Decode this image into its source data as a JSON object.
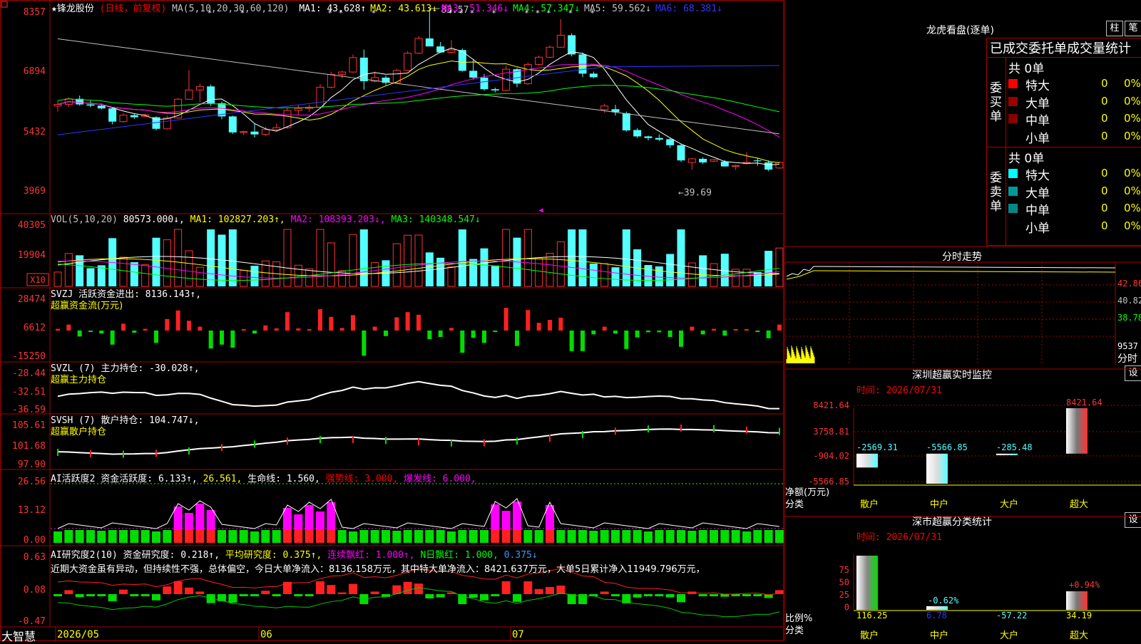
{
  "chart_header": {
    "title": "★锋龙股份",
    "mode": "(日线，前复权)",
    "ma_prefix": "MA(5,10,20,30,60,120)",
    "ma": [
      {
        "label": "MA1:",
        "value": "43.628↑",
        "color": "#ffffff"
      },
      {
        "label": "MA2:",
        "value": "43.613↓",
        "color": "#ffff00"
      },
      {
        "label": "MA3:",
        "value": "51.346↓",
        "color": "#ff00ff"
      },
      {
        "label": "MA4:",
        "value": "57.347↓",
        "color": "#00ff00"
      },
      {
        "label": "MA5:",
        "value": "59.562↓",
        "color": "#c0c0c0"
      },
      {
        "label": "MA6:",
        "value": "68.381↓",
        "color": "#3333ff"
      }
    ],
    "high_label": "83.57",
    "low_label": "←39.69"
  },
  "y_axes": {
    "price": [
      "8357",
      "6894",
      "5432",
      "3969"
    ],
    "vol": [
      "40305",
      "19904"
    ],
    "vol_unit": "X10",
    "svzj": [
      "28474",
      "6612",
      "-15250"
    ],
    "svzl": [
      "-28.44",
      "-32.51",
      "-36.59"
    ],
    "svsh": [
      "105.61",
      "101.68",
      "97.90"
    ],
    "ai1": [
      "26.56",
      "13.12",
      "0.00"
    ],
    "ai2": [
      "0.63",
      "0.08",
      "-0.47"
    ]
  },
  "panels": {
    "vol_header": "VOL(5,10,20)",
    "vol_value": "80573.000↓,",
    "vol_ma1": "MA1: 102827.203↑,",
    "vol_ma2": "MA2: 108393.203↓,",
    "vol_ma3": "MA3: 140348.547↓",
    "svzj_header": "SVZJ  活跃资金进出: 8136.143↑,",
    "svzj_sub": "超赢资金流(万元)",
    "svzl_header": "SVZL (7) 主力持仓: -30.028↑,",
    "svzl_sub": "超赢主力持仓",
    "svsh_header": "SVSH (7) 散户持仓: 104.747↓,",
    "svsh_sub": "超赢散户持仓",
    "ai1_header": "AI活跃度2 资金活跃度: 6.133↑,",
    "ai1_val2": "26.561,",
    "ai1_life": "生命线: 1.560,",
    "ai1_strong": "强势线: 3.000,",
    "ai1_burst": "爆发线: 6.000,",
    "ai2_header": "AI研究度2(10) 资金研究度: 0.218↑,",
    "ai2_avg": "平均研究度: 0.375↑,",
    "ai2_cont": "连续飘红: 1.000↑,",
    "ai2_n": "N日飘红: 1.000,",
    "ai2_last": "0.375↓",
    "ai2_comment": "近期大资金虽有异动，但持续性不强，总体偏空，今日大单净流入：8136.158万元，其中特大单净流入：8421.637万元，大单5日累计净入11949.796万元，"
  },
  "x_axis": {
    "labels": [
      "2026/05",
      "06",
      "07"
    ]
  },
  "brand": "大智慧",
  "right": {
    "lhb_title": "龙虎看盘(逐单)",
    "btn_bar": "柱",
    "btn_pen": "笔",
    "tabs": "已成交委托单成交量统计",
    "buy_side": "委买单",
    "sell_side": "委卖单",
    "buy_total": "共 0单",
    "sell_total": "共 0单",
    "buy_rows": [
      {
        "name": "特大",
        "count": "0",
        "pct": "0%",
        "color": "#ff0000"
      },
      {
        "name": "大单",
        "count": "0",
        "pct": "0%",
        "color": "#990000"
      },
      {
        "name": "中单",
        "count": "0",
        "pct": "0%",
        "color": "#880000"
      },
      {
        "name": "小单",
        "count": "0",
        "pct": "0%",
        "color": "#000000"
      }
    ],
    "sell_rows": [
      {
        "name": "特大",
        "count": "0",
        "pct": "0%",
        "color": "#00ffff"
      },
      {
        "name": "大单",
        "count": "0",
        "pct": "0%",
        "color": "#009999"
      },
      {
        "name": "中单",
        "count": "0",
        "pct": "0%",
        "color": "#008888"
      },
      {
        "name": "小单",
        "count": "0",
        "pct": "0%",
        "color": "#000000"
      }
    ],
    "fenshi_title": "分时走势",
    "fenshi_axis": [
      "42.86",
      "40.82",
      "38.78"
    ],
    "fenshi_vol": "9537",
    "fenshi_label": "分时",
    "sz_monitor_title": "深圳超赢实时监控",
    "sz_btn": "设",
    "sz_time": "时间: 2026/07/31",
    "sz_axis": [
      "8421.64",
      "3758.81",
      "-904.02",
      "-5566.85"
    ],
    "sz_unit": "净额(万元)",
    "sz_cat_label": "分类",
    "sz_categories": [
      "散户",
      "中户",
      "大户",
      "超大"
    ],
    "sz_values": [
      -2569.31,
      -5566.85,
      -285.48,
      8421.64
    ],
    "sz_value_labels": [
      "-2569.31",
      "-5566.85",
      "-285.48",
      "8421.64"
    ],
    "sc_title": "深市超赢分类统计",
    "sc_btn": "设",
    "sc_time": "时间: 2026/07/31",
    "sc_axis": [
      "75",
      "50",
      "25",
      "0"
    ],
    "sc_unit": "比例%",
    "sc_cat_label": "分类",
    "sc_categories": [
      "散户",
      "中户",
      "大户",
      "超大"
    ],
    "sc_values": [
      "116.25",
      "6.78",
      "-57.22",
      "34.19"
    ],
    "sc_bar_labels": [
      "-0.62%",
      "+0.94%"
    ]
  },
  "chart_data": [
    {
      "type": "candlestick",
      "title": "锋龙股份 (日线，前复权)",
      "ylim": [
        36.9,
        83.57
      ],
      "x": [
        "2026/05",
        "06",
        "07"
      ],
      "ohlc": [
        [
          59.2,
          60.5,
          57.8,
          59.6
        ],
        [
          59.6,
          61.4,
          59.0,
          61.0
        ],
        [
          61.0,
          61.8,
          59.3,
          59.6
        ],
        [
          59.6,
          60.5,
          58.9,
          59.3
        ],
        [
          59.3,
          59.8,
          58.4,
          58.6
        ],
        [
          58.6,
          58.9,
          54.6,
          55.3
        ],
        [
          55.3,
          57.4,
          55.0,
          56.9
        ],
        [
          56.9,
          57.3,
          56.0,
          56.4
        ],
        [
          56.6,
          57.3,
          56.5,
          57.0
        ],
        [
          56.4,
          56.6,
          53.1,
          53.5
        ],
        [
          53.5,
          56.8,
          53.3,
          56.2
        ],
        [
          56.2,
          61.2,
          56.0,
          60.9
        ],
        [
          60.9,
          68.2,
          60.8,
          63.2
        ],
        [
          63.2,
          64.8,
          60.1,
          64.1
        ],
        [
          64.1,
          64.6,
          59.2,
          59.9
        ],
        [
          59.9,
          60.3,
          55.9,
          56.6
        ],
        [
          56.6,
          56.8,
          52.2,
          52.6
        ],
        [
          52.6,
          53.0,
          51.9,
          52.8
        ],
        [
          52.8,
          54.7,
          51.3,
          52.1
        ],
        [
          52.1,
          54.0,
          51.7,
          53.3
        ],
        [
          53.3,
          54.8,
          52.9,
          53.8
        ],
        [
          53.8,
          58.8,
          53.5,
          58.1
        ],
        [
          58.1,
          59.4,
          57.0,
          58.6
        ],
        [
          58.6,
          59.5,
          57.7,
          58.9
        ],
        [
          58.9,
          64.7,
          58.5,
          63.9
        ],
        [
          63.9,
          67.8,
          63.6,
          67.1
        ],
        [
          67.1,
          68.0,
          66.1,
          67.7
        ],
        [
          67.7,
          72.1,
          67.5,
          71.3
        ],
        [
          71.3,
          73.3,
          63.3,
          65.4
        ],
        [
          65.4,
          67.8,
          65.1,
          66.3
        ],
        [
          66.3,
          66.8,
          64.4,
          65.0
        ],
        [
          65.0,
          68.5,
          64.8,
          68.1
        ],
        [
          68.1,
          72.9,
          67.9,
          72.4
        ],
        [
          72.4,
          76.7,
          72.2,
          76.1
        ],
        [
          76.1,
          83.6,
          76.0,
          74.1
        ],
        [
          74.1,
          75.2,
          72.5,
          72.6
        ],
        [
          72.6,
          75.7,
          72.3,
          73.2
        ],
        [
          73.2,
          73.6,
          67.8,
          68.0
        ],
        [
          68.0,
          70.9,
          65.8,
          66.3
        ],
        [
          66.3,
          67.2,
          63.0,
          63.4
        ],
        [
          63.4,
          63.8,
          62.6,
          63.1
        ],
        [
          63.1,
          69.3,
          62.9,
          68.4
        ],
        [
          68.4,
          68.7,
          63.9,
          64.8
        ],
        [
          64.8,
          70.1,
          64.5,
          69.6
        ],
        [
          69.6,
          71.8,
          69.2,
          71.4
        ],
        [
          71.4,
          74.4,
          71.2,
          73.9
        ],
        [
          73.9,
          80.9,
          73.7,
          76.9
        ],
        [
          76.9,
          77.4,
          71.6,
          72.1
        ],
        [
          72.1,
          72.6,
          66.4,
          67.3
        ],
        [
          67.3,
          67.8,
          66.1,
          66.4
        ],
        [
          58.3,
          59.8,
          57.5,
          59.2
        ],
        [
          58.4,
          59.5,
          56.8,
          57.7
        ],
        [
          57.4,
          57.8,
          52.8,
          53.1
        ],
        [
          53.2,
          53.7,
          51.2,
          51.6
        ],
        [
          51.6,
          51.8,
          50.6,
          51.2
        ],
        [
          51.2,
          52.1,
          50.4,
          50.8
        ],
        [
          50.9,
          51.3,
          48.7,
          49.4
        ],
        [
          49.4,
          49.7,
          45.2,
          45.6
        ],
        [
          45.1,
          46.2,
          43.3,
          46.0
        ],
        [
          46.0,
          46.4,
          44.7,
          45.1
        ],
        [
          45.4,
          46.0,
          45.1,
          45.8
        ],
        [
          45.3,
          45.7,
          44.0,
          44.1
        ],
        [
          44.1,
          44.5,
          43.2,
          44.3
        ],
        [
          44.8,
          47.6,
          44.6,
          45.1
        ],
        [
          45.6,
          46.1,
          44.3,
          45.4
        ],
        [
          45.1,
          45.6,
          42.9,
          43.3
        ],
        [
          43.7,
          45.4,
          43.5,
          45.1
        ]
      ]
    },
    {
      "type": "bar",
      "title": "深圳超赢实时监控",
      "categories": [
        "散户",
        "中户",
        "大户",
        "超大"
      ],
      "values": [
        -2569.31,
        -5566.85,
        -285.48,
        8421.64
      ],
      "ylabel": "净额(万元)",
      "ylim": [
        -5566.85,
        8421.64
      ]
    },
    {
      "type": "bar",
      "title": "深市超赢分类统计",
      "categories": [
        "散户",
        "中户",
        "大户",
        "超大"
      ],
      "values": [
        116.25,
        6.78,
        -57.22,
        34.19
      ],
      "ylabel": "比例%",
      "ylim": [
        0,
        75
      ]
    }
  ]
}
